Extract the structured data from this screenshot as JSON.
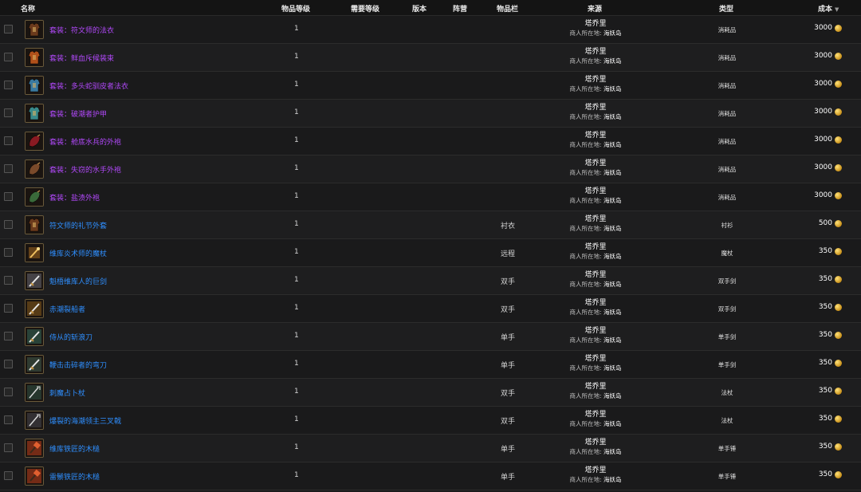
{
  "header": {
    "name": "名称",
    "item_level": "物品等级",
    "req_level": "需要等级",
    "version": "版本",
    "faction": "阵营",
    "slot": "物品栏",
    "source": "来源",
    "type": "类型",
    "cost": "成本",
    "sort_icon": "▼"
  },
  "rows": [
    {
      "name": "套装：符文师的法衣",
      "quality": "epic",
      "icon": "robe-brown-icon",
      "color": "#6b3a1c",
      "level": "1",
      "slot": "",
      "npc": "塔乔里",
      "loc_label": "商人所在地:",
      "loc": "海妖岛",
      "type": "消耗品",
      "cost": "3000"
    },
    {
      "name": "套装：鲜血斥候装束",
      "quality": "epic",
      "icon": "armor-orange-icon",
      "color": "#b0501a",
      "level": "1",
      "slot": "",
      "npc": "塔乔里",
      "loc_label": "商人所在地:",
      "loc": "海妖岛",
      "type": "消耗品",
      "cost": "3000"
    },
    {
      "name": "套装：多头蛇驯皮者法衣",
      "quality": "epic",
      "icon": "armor-blue-icon",
      "color": "#3a7aa0",
      "level": "1",
      "slot": "",
      "npc": "塔乔里",
      "loc_label": "商人所在地:",
      "loc": "海妖岛",
      "type": "消耗品",
      "cost": "3000"
    },
    {
      "name": "套装：破潮者护甲",
      "quality": "epic",
      "icon": "armor-teal-icon",
      "color": "#3a8a8a",
      "level": "1",
      "slot": "",
      "npc": "塔乔里",
      "loc_label": "商人所在地:",
      "loc": "海妖岛",
      "type": "消耗品",
      "cost": "3000"
    },
    {
      "name": "套装：舱底水兵的外袍",
      "quality": "epic",
      "icon": "bag-red-icon",
      "color": "#8a1a22",
      "level": "1",
      "slot": "",
      "npc": "塔乔里",
      "loc_label": "商人所在地:",
      "loc": "海妖岛",
      "type": "消耗品",
      "cost": "3000"
    },
    {
      "name": "套装：失窃的水手外袍",
      "quality": "epic",
      "icon": "bag-brown-icon",
      "color": "#7a4a2a",
      "level": "1",
      "slot": "",
      "npc": "塔乔里",
      "loc_label": "商人所在地:",
      "loc": "海妖岛",
      "type": "消耗品",
      "cost": "3000"
    },
    {
      "name": "套装：盐渍外袍",
      "quality": "epic",
      "icon": "bag-green-icon",
      "color": "#3a6a3a",
      "level": "1",
      "slot": "",
      "npc": "塔乔里",
      "loc_label": "商人所在地:",
      "loc": "海妖岛",
      "type": "消耗品",
      "cost": "3000"
    },
    {
      "name": "符文师的礼节外套",
      "quality": "rare",
      "icon": "robe-brown-icon",
      "color": "#6b3a1c",
      "level": "1",
      "slot": "衬衣",
      "npc": "塔乔里",
      "loc_label": "商人所在地:",
      "loc": "海妖岛",
      "type": "衬衫",
      "cost": "500"
    },
    {
      "name": "维库炎术师的魔杖",
      "quality": "rare",
      "icon": "wand-icon",
      "color": "#b07020",
      "level": "1",
      "slot": "远程",
      "npc": "塔乔里",
      "loc_label": "商人所在地:",
      "loc": "海妖岛",
      "type": "魔杖",
      "cost": "350"
    },
    {
      "name": "魁梧维库人的巨剑",
      "quality": "rare",
      "icon": "greatsword-icon",
      "color": "#7a7a8a",
      "level": "1",
      "slot": "双手",
      "npc": "塔乔里",
      "loc_label": "商人所在地:",
      "loc": "海妖岛",
      "type": "双手剑",
      "cost": "350"
    },
    {
      "name": "赤潮裂船者",
      "quality": "rare",
      "icon": "sword-gold-icon",
      "color": "#a06a20",
      "level": "1",
      "slot": "双手",
      "npc": "塔乔里",
      "loc_label": "商人所在地:",
      "loc": "海妖岛",
      "type": "双手剑",
      "cost": "350"
    },
    {
      "name": "侍从的斩浪刀",
      "quality": "rare",
      "icon": "blade-teal-icon",
      "color": "#3a7a6a",
      "level": "1",
      "slot": "单手",
      "npc": "塔乔里",
      "loc_label": "商人所在地:",
      "loc": "海妖岛",
      "type": "单手剑",
      "cost": "350"
    },
    {
      "name": "鞭击击碎者的弯刀",
      "quality": "rare",
      "icon": "scimitar-icon",
      "color": "#4a6a5a",
      "level": "1",
      "slot": "单手",
      "npc": "塔乔里",
      "loc_label": "商人所在地:",
      "loc": "海妖岛",
      "type": "单手剑",
      "cost": "350"
    },
    {
      "name": "刺魔占卜杖",
      "quality": "rare",
      "icon": "staff-icon",
      "color": "#3a6a5a",
      "level": "1",
      "slot": "双手",
      "npc": "塔乔里",
      "loc_label": "商人所在地:",
      "loc": "海妖岛",
      "type": "法杖",
      "cost": "350"
    },
    {
      "name": "爆裂的海潮领主三叉戟",
      "quality": "rare",
      "icon": "trident-icon",
      "color": "#5a5a6a",
      "level": "1",
      "slot": "双手",
      "npc": "塔乔里",
      "loc_label": "商人所在地:",
      "loc": "海妖岛",
      "type": "法杖",
      "cost": "350"
    },
    {
      "name": "维库铁匠的木槌",
      "quality": "rare",
      "icon": "mace-red-icon",
      "color": "#b03a1a",
      "level": "1",
      "slot": "单手",
      "npc": "塔乔里",
      "loc_label": "商人所在地:",
      "loc": "海妖岛",
      "type": "单手锤",
      "cost": "350"
    },
    {
      "name": "雷鬃铁匠的木槌",
      "quality": "rare",
      "icon": "mace-red-icon",
      "color": "#b03a1a",
      "level": "1",
      "slot": "单手",
      "npc": "塔乔里",
      "loc_label": "商人所在地:",
      "loc": "海妖岛",
      "type": "单手锤",
      "cost": "350"
    }
  ]
}
